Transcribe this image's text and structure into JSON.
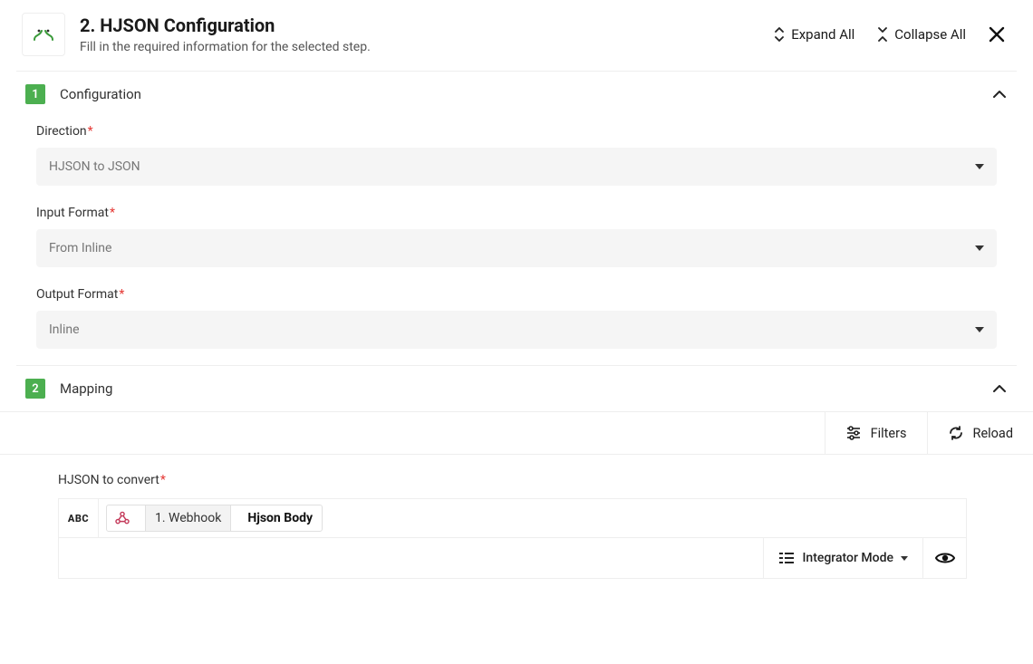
{
  "header": {
    "title": "2. HJSON Configuration",
    "subtitle": "Fill in the required information for the selected step.",
    "expand_label": "Expand All",
    "collapse_label": "Collapse All"
  },
  "sections": {
    "config": {
      "number": "1",
      "title": "Configuration",
      "fields": {
        "direction": {
          "label": "Direction",
          "value": "HJSON to JSON"
        },
        "input_format": {
          "label": "Input Format",
          "value": "From Inline"
        },
        "output_format": {
          "label": "Output Format",
          "value": "Inline"
        }
      }
    },
    "mapping": {
      "number": "2",
      "title": "Mapping",
      "toolbar": {
        "filters": "Filters",
        "reload": "Reload"
      },
      "field_label": "HJSON to convert",
      "abc_chip": "ABC",
      "token": {
        "step": "1. Webhook",
        "name": "Hjson Body"
      },
      "mode_label": "Integrator Mode"
    }
  }
}
